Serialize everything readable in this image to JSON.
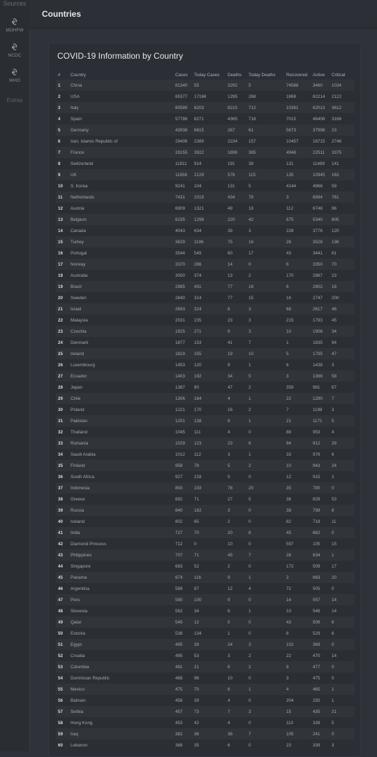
{
  "sidebar": {
    "title": "Sources",
    "items": [
      {
        "label": "MOHFW",
        "icon": "link-icon"
      },
      {
        "label": "NCDC",
        "icon": "link-icon"
      },
      {
        "label": "WHO",
        "icon": "link-icon"
      }
    ],
    "extras": "Extras"
  },
  "header": {
    "title": "Countries"
  },
  "card": {
    "title": "COVID-19 Information by Country"
  },
  "table": {
    "columns": [
      "#",
      "Country",
      "Cases",
      "Today Cases",
      "Deaths",
      "Today Deaths",
      "Recovered",
      "Active",
      "Critical"
    ],
    "rows": [
      [
        "1",
        "China",
        "81340",
        "55",
        "3292",
        "5",
        "74588",
        "3460",
        "1034"
      ],
      [
        "2",
        "USA",
        "85377",
        "17166",
        "1295",
        "268",
        "1868",
        "82214",
        "2122"
      ],
      [
        "3",
        "Italy",
        "80589",
        "6203",
        "8215",
        "712",
        "10361",
        "62013",
        "3612"
      ],
      [
        "4",
        "Spain",
        "57786",
        "8271",
        "4365",
        "718",
        "7015",
        "46406",
        "3166"
      ],
      [
        "5",
        "Germany",
        "43938",
        "6615",
        "267",
        "61",
        "5673",
        "37998",
        "23"
      ],
      [
        "6",
        "Iran, Islamic Republic of",
        "29406",
        "2389",
        "2234",
        "157",
        "10457",
        "16715",
        "2746"
      ],
      [
        "7",
        "France",
        "29155",
        "3922",
        "1696",
        "365",
        "4948",
        "22511",
        "3375"
      ],
      [
        "8",
        "Switzerland",
        "11811",
        "914",
        "191",
        "38",
        "131",
        "11489",
        "141"
      ],
      [
        "9",
        "UK",
        "11658",
        "2129",
        "578",
        "115",
        "135",
        "10945",
        "163"
      ],
      [
        "10",
        "S. Korea",
        "9241",
        "104",
        "131",
        "5",
        "4144",
        "4966",
        "59"
      ],
      [
        "11",
        "Netherlands",
        "7431",
        "1019",
        "434",
        "78",
        "3",
        "6994",
        "761"
      ],
      [
        "12",
        "Austria",
        "6909",
        "1321",
        "49",
        "18",
        "112",
        "6748",
        "96"
      ],
      [
        "13",
        "Belgium",
        "6235",
        "1298",
        "220",
        "42",
        "675",
        "5340",
        "605"
      ],
      [
        "14",
        "Canada",
        "4043",
        "634",
        "39",
        "3",
        "228",
        "3776",
        "120"
      ],
      [
        "15",
        "Turkey",
        "3629",
        "1196",
        "75",
        "16",
        "26",
        "3528",
        "136"
      ],
      [
        "16",
        "Portugal",
        "3544",
        "549",
        "60",
        "17",
        "43",
        "3441",
        "61"
      ],
      [
        "17",
        "Norway",
        "3370",
        "286",
        "14",
        "0",
        "6",
        "3350",
        "70"
      ],
      [
        "18",
        "Australia",
        "3050",
        "374",
        "13",
        "2",
        "170",
        "2867",
        "23"
      ],
      [
        "19",
        "Brazil",
        "2985",
        "431",
        "77",
        "18",
        "6",
        "2902",
        "18"
      ],
      [
        "20",
        "Sweden",
        "2840",
        "314",
        "77",
        "15",
        "16",
        "2747",
        "200"
      ],
      [
        "21",
        "Israel",
        "2693",
        "324",
        "8",
        "3",
        "68",
        "2617",
        "46"
      ],
      [
        "22",
        "Malaysia",
        "2031",
        "235",
        "23",
        "3",
        "215",
        "1793",
        "45"
      ],
      [
        "23",
        "Czechia",
        "1925",
        "271",
        "9",
        "3",
        "10",
        "1906",
        "34"
      ],
      [
        "24",
        "Denmark",
        "1877",
        "153",
        "41",
        "7",
        "1",
        "1835",
        "94"
      ],
      [
        "25",
        "Ireland",
        "1819",
        "255",
        "19",
        "10",
        "5",
        "1795",
        "47"
      ],
      [
        "26",
        "Luxembourg",
        "1453",
        "120",
        "9",
        "1",
        "6",
        "1438",
        "3"
      ],
      [
        "27",
        "Ecuador",
        "1403",
        "192",
        "34",
        "5",
        "3",
        "1366",
        "58"
      ],
      [
        "28",
        "Japan",
        "1387",
        "80",
        "47",
        "2",
        "359",
        "981",
        "67"
      ],
      [
        "29",
        "Chile",
        "1306",
        "164",
        "4",
        "1",
        "22",
        "1280",
        "7"
      ],
      [
        "30",
        "Poland",
        "1221",
        "170",
        "16",
        "2",
        "7",
        "1198",
        "3"
      ],
      [
        "31",
        "Pakistan",
        "1201",
        "138",
        "9",
        "1",
        "21",
        "1171",
        "5"
      ],
      [
        "32",
        "Thailand",
        "1045",
        "111",
        "4",
        "0",
        "88",
        "953",
        "4"
      ],
      [
        "33",
        "Romania",
        "1029",
        "123",
        "23",
        "6",
        "94",
        "912",
        "29"
      ],
      [
        "34",
        "Saudi Arabia",
        "1012",
        "112",
        "3",
        "1",
        "33",
        "976",
        "6"
      ],
      [
        "35",
        "Finland",
        "958",
        "78",
        "5",
        "2",
        "10",
        "943",
        "24"
      ],
      [
        "36",
        "South Africa",
        "927",
        "218",
        "0",
        "0",
        "12",
        "915",
        "2"
      ],
      [
        "37",
        "Indonesia",
        "893",
        "103",
        "78",
        "20",
        "35",
        "780",
        "0"
      ],
      [
        "38",
        "Greece",
        "892",
        "71",
        "27",
        "5",
        "36",
        "829",
        "53"
      ],
      [
        "39",
        "Russia",
        "840",
        "182",
        "3",
        "0",
        "38",
        "799",
        "8"
      ],
      [
        "40",
        "Iceland",
        "802",
        "65",
        "2",
        "0",
        "82",
        "718",
        "11"
      ],
      [
        "41",
        "India",
        "727",
        "70",
        "20",
        "8",
        "45",
        "662",
        "0"
      ],
      [
        "42",
        "Diamond Princess",
        "712",
        "0",
        "10",
        "0",
        "597",
        "105",
        "15"
      ],
      [
        "43",
        "Philippines",
        "707",
        "71",
        "45",
        "7",
        "28",
        "634",
        "1"
      ],
      [
        "44",
        "Singapore",
        "683",
        "52",
        "2",
        "0",
        "172",
        "509",
        "17"
      ],
      [
        "45",
        "Panama",
        "674",
        "116",
        "9",
        "1",
        "2",
        "663",
        "20"
      ],
      [
        "46",
        "Argentina",
        "589",
        "87",
        "12",
        "4",
        "72",
        "505",
        "0"
      ],
      [
        "47",
        "Peru",
        "580",
        "100",
        "9",
        "0",
        "14",
        "557",
        "14"
      ],
      [
        "48",
        "Slovenia",
        "562",
        "34",
        "6",
        "1",
        "10",
        "546",
        "14"
      ],
      [
        "49",
        "Qatar",
        "549",
        "12",
        "0",
        "0",
        "43",
        "506",
        "6"
      ],
      [
        "50",
        "Estonia",
        "538",
        "134",
        "1",
        "0",
        "8",
        "529",
        "6"
      ],
      [
        "51",
        "Egypt",
        "495",
        "39",
        "24",
        "3",
        "102",
        "369",
        "0"
      ],
      [
        "52",
        "Croatia",
        "495",
        "53",
        "3",
        "2",
        "22",
        "470",
        "14"
      ],
      [
        "53",
        "Colombia",
        "491",
        "21",
        "6",
        "2",
        "8",
        "477",
        "0"
      ],
      [
        "54",
        "Dominican Republic",
        "488",
        "96",
        "10",
        "0",
        "3",
        "475",
        "0"
      ],
      [
        "55",
        "Mexico",
        "475",
        "70",
        "6",
        "1",
        "4",
        "465",
        "1"
      ],
      [
        "56",
        "Bahrain",
        "458",
        "39",
        "4",
        "0",
        "204",
        "250",
        "1"
      ],
      [
        "57",
        "Serbia",
        "457",
        "73",
        "7",
        "3",
        "15",
        "435",
        "21"
      ],
      [
        "58",
        "Hong Kong",
        "453",
        "42",
        "4",
        "0",
        "110",
        "339",
        "5"
      ],
      [
        "59",
        "Iraq",
        "382",
        "36",
        "36",
        "7",
        "105",
        "241",
        "0"
      ],
      [
        "60",
        "Lebanon",
        "368",
        "35",
        "6",
        "0",
        "23",
        "339",
        "3"
      ]
    ]
  }
}
